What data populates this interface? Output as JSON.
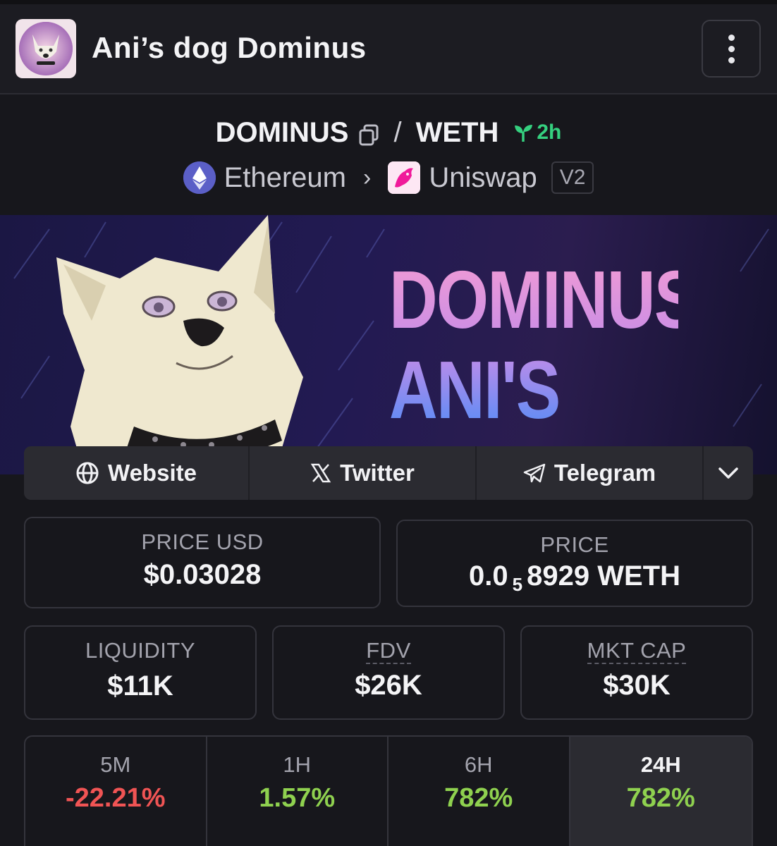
{
  "header": {
    "title": "Ani’s dog Dominus"
  },
  "pair": {
    "base": "DOMINUS",
    "separator": "/",
    "quote": "WETH",
    "age": "2h",
    "chain": "Ethereum",
    "dex": "Uniswap",
    "dex_version": "V2"
  },
  "banner": {
    "line1": "DOMINUS",
    "line2": "ANI'S DOG"
  },
  "links": {
    "website": "Website",
    "twitter": "Twitter",
    "telegram": "Telegram"
  },
  "stats": {
    "price_usd_label": "PRICE USD",
    "price_usd": "$0.03028",
    "price_label": "PRICE",
    "price_prefix": "0.0",
    "price_zeros": "5",
    "price_digits": "8929",
    "price_unit": "WETH",
    "liquidity_label": "LIQUIDITY",
    "liquidity": "$11K",
    "fdv_label": "FDV",
    "fdv": "$26K",
    "mktcap_label": "MKT CAP",
    "mktcap": "$30K"
  },
  "changes": [
    {
      "label": "5M",
      "value": "-22.21%"
    },
    {
      "label": "1H",
      "value": "1.57%"
    },
    {
      "label": "6H",
      "value": "782%"
    },
    {
      "label": "24H",
      "value": "782%"
    }
  ],
  "colors": {
    "positive": "#8fd14f",
    "negative": "#f05454",
    "age_green": "#35d07f",
    "background": "#17171c"
  }
}
